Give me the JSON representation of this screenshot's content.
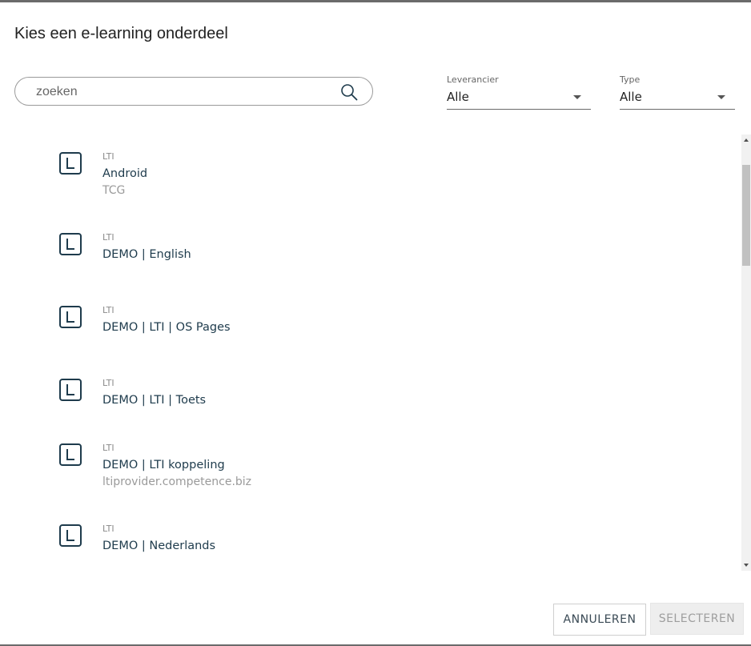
{
  "dialog": {
    "title": "Kies een e-learning onderdeel"
  },
  "search": {
    "placeholder": "zoeken",
    "value": ""
  },
  "filters": {
    "supplier": {
      "label": "Leverancier",
      "value": "Alle"
    },
    "type": {
      "label": "Type",
      "value": "Alle"
    }
  },
  "items": [
    {
      "type": "LTI",
      "name": "Android",
      "sub": "TCG"
    },
    {
      "type": "LTI",
      "name": "DEMO | English",
      "sub": ""
    },
    {
      "type": "LTI",
      "name": "DEMO | LTI | OS Pages",
      "sub": ""
    },
    {
      "type": "LTI",
      "name": "DEMO | LTI | Toets",
      "sub": ""
    },
    {
      "type": "LTI",
      "name": "DEMO | LTI koppeling",
      "sub": "ltiprovider.competence.biz"
    },
    {
      "type": "LTI",
      "name": "DEMO | Nederlands",
      "sub": ""
    }
  ],
  "icons": {
    "item": "lti-icon",
    "search": "search-icon"
  },
  "colors": {
    "accent": "#1e3b4c",
    "muted": "#9a9a9a"
  },
  "buttons": {
    "cancel": "ANNULEREN",
    "select": "SELECTEREN"
  }
}
